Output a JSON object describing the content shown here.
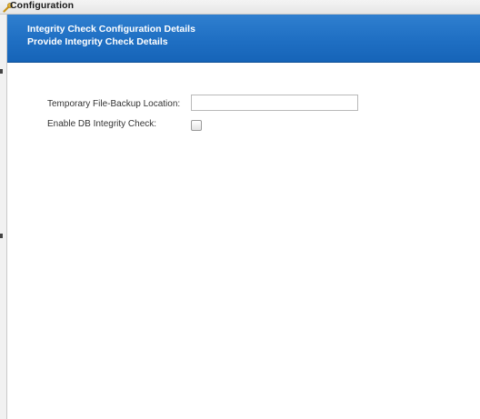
{
  "window": {
    "title": "Configuration",
    "icon": "wrench-icon"
  },
  "header": {
    "line1": "Integrity Check Configuration Details",
    "line2": "Provide Integrity Check Details",
    "color": "#1f6fc3"
  },
  "form": {
    "backup_location": {
      "label": "Temporary File-Backup Location:",
      "value": "",
      "placeholder": ""
    },
    "enable_db_check": {
      "label": "Enable DB Integrity Check:",
      "checked": false
    }
  }
}
